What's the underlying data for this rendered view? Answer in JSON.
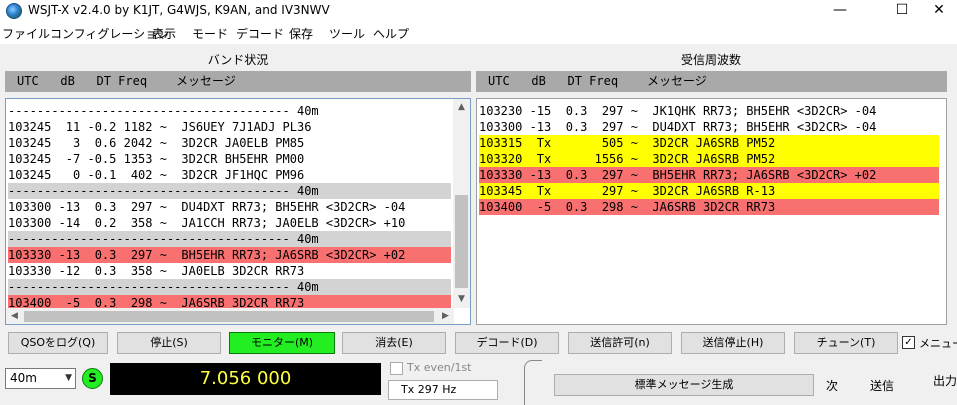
{
  "window": {
    "title": "WSJT-X   v2.4.0   by K1JT, G4WJS, K9AN, and IV3NWV",
    "minimize": "—",
    "maximize": "☐",
    "close": "✕"
  },
  "menu": [
    "ファイル",
    "コンフィグレーション",
    "表示",
    "モード",
    "デコード",
    "保存",
    "ツール",
    "ヘルプ"
  ],
  "band_activity": {
    "title": "バンド状況",
    "header": "UTC   dB   DT Freq    メッセージ",
    "rows": [
      {
        "text": "--------------------------------------- 40m",
        "bg": "#ffffff"
      },
      {
        "text": "103245  11 -0.2 1182 ~  JS6UEY 7J1ADJ PL36",
        "bg": "#ffffff"
      },
      {
        "text": "103245   3  0.6 2042 ~  3D2CR JA0ELB PM85",
        "bg": "#ffffff"
      },
      {
        "text": "103245  -7 -0.5 1353 ~  3D2CR BH5EHR PM00",
        "bg": "#ffffff"
      },
      {
        "text": "103245   0 -0.1  402 ~  3D2CR JF1HQC PM96",
        "bg": "#ffffff"
      },
      {
        "text": "--------------------------------------- 40m",
        "bg": "#d3d3d3"
      },
      {
        "text": "103300 -13  0.3  297 ~  DU4DXT RR73; BH5EHR <3D2CR> -04",
        "bg": "#ffffff"
      },
      {
        "text": "103300 -14  0.2  358 ~  JA1CCH RR73; JA0ELB <3D2CR> +10",
        "bg": "#ffffff"
      },
      {
        "text": "--------------------------------------- 40m",
        "bg": "#d3d3d3"
      },
      {
        "text": "103330 -13  0.3  297 ~  BH5EHR RR73; JA6SRB <3D2CR> +02",
        "bg": "#f87070"
      },
      {
        "text": "103330 -12  0.3  358 ~  JA0ELB 3D2CR RR73",
        "bg": "#ffffff"
      },
      {
        "text": "--------------------------------------- 40m",
        "bg": "#d3d3d3"
      },
      {
        "text": "103400  -5  0.3  298 ~  JA6SRB 3D2CR RR73",
        "bg": "#f87070"
      }
    ]
  },
  "rx_frequency": {
    "title": "受信周波数",
    "header": "UTC   dB   DT Freq    メッセージ",
    "rows": [
      {
        "text": "103230 -15  0.3  297 ~  JK1QHK RR73; BH5EHR <3D2CR> -04",
        "bg": "#ffffff"
      },
      {
        "text": "103300 -13  0.3  297 ~  DU4DXT RR73; BH5EHR <3D2CR> -04",
        "bg": "#ffffff"
      },
      {
        "text": "103315  Tx       505 ~  3D2CR JA6SRB PM52",
        "bg": "#ffff00"
      },
      {
        "text": "103320  Tx      1556 ~  3D2CR JA6SRB PM52",
        "bg": "#ffff00"
      },
      {
        "text": "103330 -13  0.3  297 ~  BH5EHR RR73; JA6SRB <3D2CR> +02",
        "bg": "#f87070"
      },
      {
        "text": "103345  Tx       297 ~  3D2CR JA6SRB R-13",
        "bg": "#ffff00"
      },
      {
        "text": "103400  -5  0.3  298 ~  JA6SRB 3D2CR RR73",
        "bg": "#f87070"
      }
    ]
  },
  "buttons": {
    "log_qso": "QSOをログ(Q)",
    "stop": "停止(S)",
    "monitor": "モニター(M)",
    "erase": "消去(E)",
    "decode": "デコード(D)",
    "enable_tx": "送信許可(n)",
    "halt_tx": "送信停止(H)",
    "tune": "チューン(T)",
    "menu_label": "メニュー"
  },
  "controls": {
    "band": "40m",
    "s_badge": "S",
    "frequency": "7.056 000",
    "tx_even_label": "Tx even/1st",
    "tx_freq": "Tx  297  Hz",
    "generate_std": "標準メッセージ生成",
    "next_label": "次",
    "send_label": "送信",
    "output_label": "出力"
  },
  "colors": {
    "own_call_highlight": "#f87070",
    "tx_highlight": "#ffff00",
    "separator": "#d3d3d3",
    "monitor_on": "#22ee22",
    "freq_text": "#ffff40"
  }
}
